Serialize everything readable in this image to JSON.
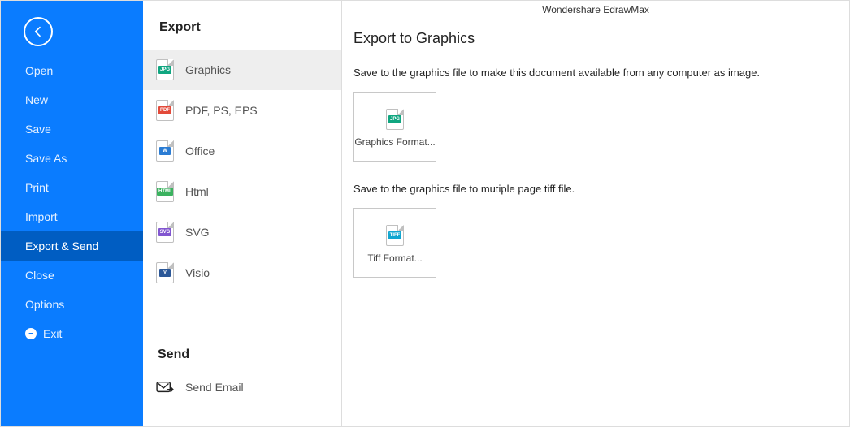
{
  "app_title": "Wondershare EdrawMax",
  "sidebar": {
    "items": [
      {
        "label": "Open"
      },
      {
        "label": "New"
      },
      {
        "label": "Save"
      },
      {
        "label": "Save As"
      },
      {
        "label": "Print"
      },
      {
        "label": "Import"
      },
      {
        "label": "Export & Send"
      },
      {
        "label": "Close"
      },
      {
        "label": "Options"
      }
    ],
    "exit_label": "Exit"
  },
  "export": {
    "heading": "Export",
    "items": [
      {
        "label": "Graphics",
        "badge": "JPG"
      },
      {
        "label": "PDF, PS, EPS",
        "badge": "PDF"
      },
      {
        "label": "Office",
        "badge": "W"
      },
      {
        "label": "Html",
        "badge": "HTML"
      },
      {
        "label": "SVG",
        "badge": "SVG"
      },
      {
        "label": "Visio",
        "badge": "V"
      }
    ]
  },
  "send": {
    "heading": "Send",
    "email_label": "Send Email"
  },
  "content": {
    "title": "Export to Graphics",
    "desc1": "Save to the graphics file to make this document available from any computer as image.",
    "tile1": {
      "badge": "JPG",
      "label": "Graphics Format..."
    },
    "desc2": "Save to the graphics file to mutiple page tiff file.",
    "tile2": {
      "badge": "TIFF",
      "label": "Tiff Format..."
    }
  }
}
